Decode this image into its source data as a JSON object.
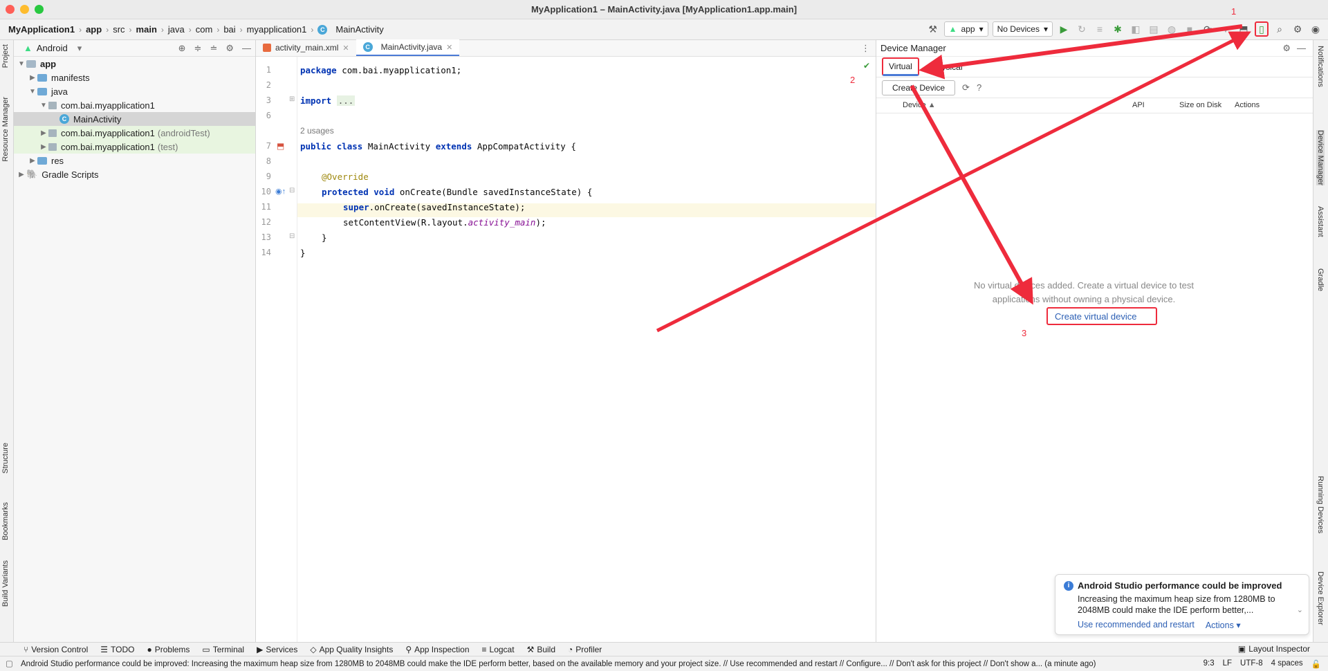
{
  "window": {
    "title": "MyApplication1 – MainActivity.java [MyApplication1.app.main]"
  },
  "breadcrumbs": [
    "MyApplication1",
    "app",
    "src",
    "main",
    "java",
    "com",
    "bai",
    "myapplication1",
    "MainActivity"
  ],
  "toolbar": {
    "run_config": "app",
    "device_select": "No Devices"
  },
  "left_strip": {
    "project": "Project",
    "resource_manager": "Resource Manager",
    "structure": "Structure",
    "bookmarks": "Bookmarks",
    "build_variants": "Build Variants"
  },
  "right_strip": {
    "notifications": "Notifications",
    "device_manager": "Device Manager",
    "assistant": "Assistant",
    "gradle": "Gradle",
    "running_devices": "Running Devices",
    "device_explorer": "Device Explorer"
  },
  "project": {
    "view": "Android",
    "tree": [
      {
        "label": "app",
        "extra": ""
      },
      {
        "label": "manifests",
        "extra": ""
      },
      {
        "label": "java",
        "extra": ""
      },
      {
        "label": "com.bai.myapplication1",
        "extra": ""
      },
      {
        "label": "MainActivity",
        "extra": ""
      },
      {
        "label": "com.bai.myapplication1",
        "extra": "(androidTest)"
      },
      {
        "label": "com.bai.myapplication1",
        "extra": "(test)"
      },
      {
        "label": "res",
        "extra": ""
      },
      {
        "label": "Gradle Scripts",
        "extra": ""
      }
    ]
  },
  "editor": {
    "tabs": [
      "activity_main.xml",
      "MainActivity.java"
    ],
    "line_numbers": [
      "1",
      "2",
      "3",
      "6",
      "7",
      "8",
      "9",
      "10",
      "11",
      "12",
      "13",
      "14"
    ],
    "code": {
      "l1_kw": "package",
      "l1_rest": " com.bai.myapplication1;",
      "l3_kw": "import",
      "l3_fold": "...",
      "usages": "2 usages",
      "l7_a": "public",
      "l7_b": " ",
      "l7_c": "class",
      "l7_d": " MainActivity ",
      "l7_e": "extends",
      "l7_f": " AppCompatActivity {",
      "l9": "@Override",
      "l10_a": "protected",
      "l10_b": " ",
      "l10_c": "void",
      "l10_d": " onCreate(Bundle savedInstanceState) {",
      "l11_kw": "super",
      "l11_rest": ".onCreate(savedInstanceState);",
      "l12_a": "setContentView(R.layout.",
      "l12_b": "activity_main",
      "l12_c": ");",
      "l13": "}",
      "l14": "}"
    }
  },
  "device_manager": {
    "title": "Device Manager",
    "tabs": [
      "Virtual",
      "Physical"
    ],
    "create_button": "Create Device",
    "columns": [
      "Device",
      "API",
      "Size on Disk",
      "Actions"
    ],
    "empty_message": "No virtual devices added. Create a virtual device to test applications without owning a physical device.",
    "create_link": "Create virtual device"
  },
  "annotations": {
    "one": "1",
    "two": "2",
    "three": "3",
    "arrow_color": "#ee2b3c"
  },
  "notification": {
    "title": "Android Studio performance could be improved",
    "body": "Increasing the maximum heap size from 1280MB to 2048MB could make the IDE perform better,...",
    "action_primary": "Use recommended and restart",
    "action_secondary": "Actions"
  },
  "bottom_tools": [
    "Version Control",
    "TODO",
    "Problems",
    "Terminal",
    "Services",
    "App Quality Insights",
    "App Inspection",
    "Logcat",
    "Build",
    "Profiler"
  ],
  "layout_inspector": "Layout Inspector",
  "status": {
    "message": "Android Studio performance could be improved: Increasing the maximum heap size from 1280MB to 2048MB could make the IDE perform better, based on the available memory and your project size. // Use recommended and restart // Configure... // Don't ask for this project // Don't show a... (a minute ago)",
    "position": "9:3",
    "line_sep": "LF",
    "encoding": "UTF-8",
    "indent": "4 spaces"
  }
}
